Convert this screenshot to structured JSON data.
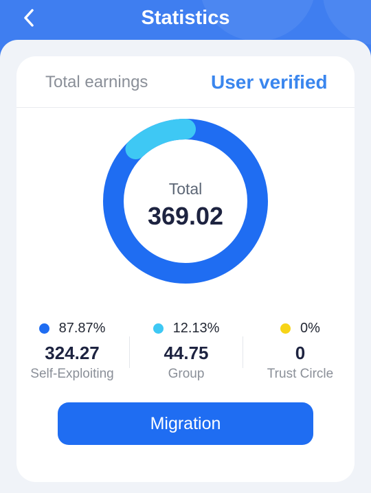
{
  "header": {
    "title": "Statistics",
    "back_icon": "chevron-left-icon"
  },
  "tabs": [
    {
      "label": "Total earnings",
      "active": false
    },
    {
      "label": "User verified",
      "active": true
    }
  ],
  "summary": {
    "total_label": "Total",
    "total_value": "369.02"
  },
  "breakdown": [
    {
      "percent": "87.87%",
      "value": "324.27",
      "label": "Self-Exploiting",
      "color": "#1f6df2",
      "share": 0.8787
    },
    {
      "percent": "12.13%",
      "value": "44.75",
      "label": "Group",
      "color": "#3ec8f4",
      "share": 0.1213
    },
    {
      "percent": "0%",
      "value": "0",
      "label": "Trust Circle",
      "color": "#f7d417",
      "share": 0
    }
  ],
  "actions": {
    "migration_label": "Migration"
  },
  "colors": {
    "header": "#3f7ef0",
    "accent": "#3a86ee",
    "button": "#1f6df2"
  }
}
